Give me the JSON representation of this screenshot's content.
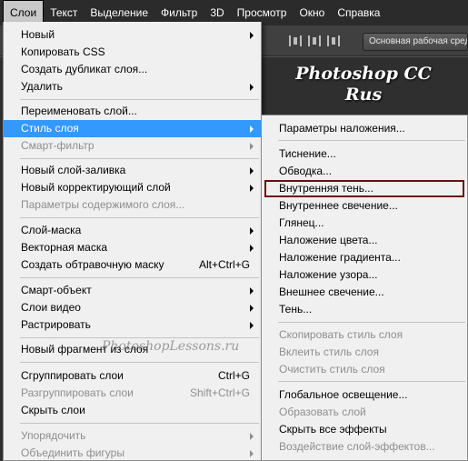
{
  "menubar": {
    "items": [
      "Слои",
      "Текст",
      "Выделение",
      "Фильтр",
      "3D",
      "Просмотр",
      "Окно",
      "Справка"
    ],
    "active_index": 0
  },
  "app": {
    "workspace": "Основная рабочая среда",
    "brand_line1": "Photoshop CC",
    "brand_line2": "Rus"
  },
  "watermark": "PhotoshopLessons.ru",
  "layer_menu": {
    "items": [
      {
        "label": "Новый",
        "arrow": true
      },
      {
        "label": "Копировать CSS"
      },
      {
        "label": "Создать дубликат слоя..."
      },
      {
        "label": "Удалить",
        "arrow": true
      },
      {
        "label": "Переименовать слой..."
      },
      {
        "label": "Стиль слоя",
        "arrow": true,
        "highlighted": true
      },
      {
        "label": "Смарт-фильтр",
        "arrow": true,
        "disabled": true
      },
      {
        "label": "Новый слой-заливка",
        "arrow": true
      },
      {
        "label": "Новый корректирующий слой",
        "arrow": true
      },
      {
        "label": "Параметры содержимого слоя...",
        "disabled": true
      },
      {
        "label": "Слой-маска",
        "arrow": true
      },
      {
        "label": "Векторная маска",
        "arrow": true
      },
      {
        "label": "Создать обтравочную маску",
        "shortcut": "Alt+Ctrl+G"
      },
      {
        "label": "Смарт-объект",
        "arrow": true
      },
      {
        "label": "Слои видео",
        "arrow": true
      },
      {
        "label": "Растрировать",
        "arrow": true
      },
      {
        "label": "Новый фрагмент из слоя"
      },
      {
        "label": "Сгруппировать слои",
        "shortcut": "Ctrl+G"
      },
      {
        "label": "Разгруппировать слои",
        "shortcut": "Shift+Ctrl+G",
        "disabled": true
      },
      {
        "label": "Скрыть слои"
      },
      {
        "label": "Упорядочить",
        "arrow": true,
        "disabled": true
      },
      {
        "label": "Объединить фигуры",
        "arrow": true,
        "disabled": true
      }
    ]
  },
  "style_menu": {
    "items": [
      {
        "label": "Параметры наложения..."
      },
      {
        "label": "Тиснение..."
      },
      {
        "label": "Обводка..."
      },
      {
        "label": "Внутренняя тень...",
        "boxed": true
      },
      {
        "label": "Внутреннее свечение..."
      },
      {
        "label": "Глянец..."
      },
      {
        "label": "Наложение цвета..."
      },
      {
        "label": "Наложение градиента..."
      },
      {
        "label": "Наложение узора..."
      },
      {
        "label": "Внешнее свечение..."
      },
      {
        "label": "Тень..."
      },
      {
        "label": "Скопировать стиль слоя",
        "disabled": true
      },
      {
        "label": "Вклеить стиль слоя",
        "disabled": true
      },
      {
        "label": "Очистить стиль слоя",
        "disabled": true
      },
      {
        "label": "Глобальное освещение..."
      },
      {
        "label": "Образовать слой",
        "disabled": true
      },
      {
        "label": "Скрыть все эффекты"
      },
      {
        "label": "Воздействие слой-эффектов...",
        "disabled": true
      }
    ]
  }
}
